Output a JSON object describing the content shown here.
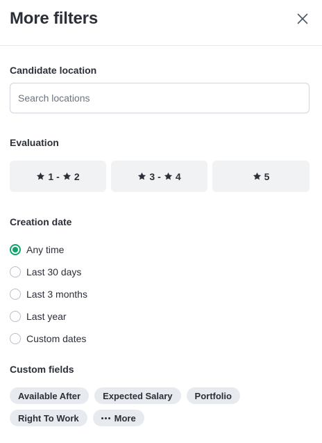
{
  "header": {
    "title": "More filters",
    "close_icon": "close-icon"
  },
  "location": {
    "label": "Candidate location",
    "placeholder": "Search locations",
    "value": ""
  },
  "evaluation": {
    "label": "Evaluation",
    "icon": "star-icon",
    "options": [
      {
        "from": "1",
        "sep": "-",
        "to": "2"
      },
      {
        "from": "3",
        "sep": "-",
        "to": "4"
      },
      {
        "from": "5"
      }
    ]
  },
  "creation_date": {
    "label": "Creation date",
    "selected": "Any time",
    "options": [
      "Any time",
      "Last 30 days",
      "Last 3 months",
      "Last year",
      "Custom dates"
    ]
  },
  "custom_fields": {
    "label": "Custom fields",
    "chips": [
      "Available After",
      "Expected Salary",
      "Portfolio",
      "Right To Work"
    ],
    "more_label": "More",
    "more_icon": "ellipsis-icon"
  },
  "colors": {
    "accent": "#12a26b",
    "chip_bg": "#e7eaef",
    "button_bg": "#f1f2f4"
  }
}
